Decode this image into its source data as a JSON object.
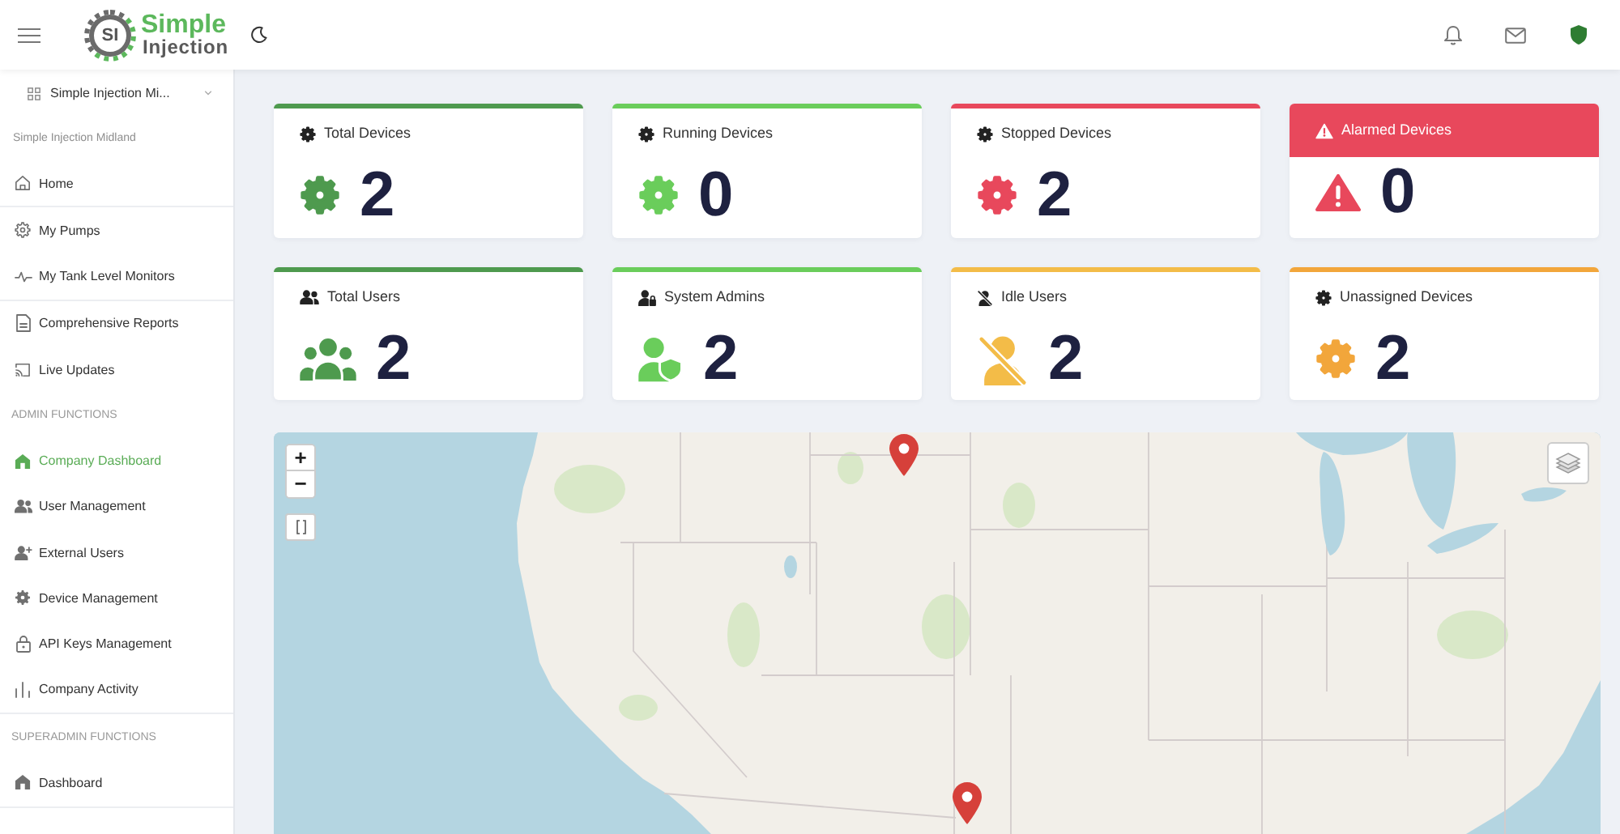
{
  "header": {
    "logo": {
      "badge": "SI",
      "name": "Simple",
      "tagline": "Injection"
    }
  },
  "sidebar": {
    "company_select": {
      "value": "Simple Injection Mi..."
    },
    "company_name": "Simple Injection Midland",
    "groups": [
      {
        "entries": [
          {
            "kind": "link",
            "label": "Home",
            "selected": false
          }
        ]
      },
      {
        "entries": [
          {
            "kind": "link",
            "label": "My Pumps",
            "selected": false
          },
          {
            "kind": "link",
            "label": "My Tank Level Monitors",
            "selected": false
          }
        ]
      },
      {
        "entries": [
          {
            "kind": "link",
            "label": "Comprehensive Reports",
            "selected": false
          },
          {
            "kind": "link",
            "label": "Live Updates",
            "selected": false
          },
          {
            "kind": "heading",
            "label": "ADMIN FUNCTIONS"
          },
          {
            "kind": "link",
            "label": "Company Dashboard",
            "selected": true
          },
          {
            "kind": "link",
            "label": "User Management",
            "selected": false
          },
          {
            "kind": "link",
            "label": "External Users",
            "selected": false
          },
          {
            "kind": "link",
            "label": "Device Management",
            "selected": false
          },
          {
            "kind": "link",
            "label": "API Keys Management",
            "selected": false
          },
          {
            "kind": "link",
            "label": "Company Activity",
            "selected": false
          }
        ]
      },
      {
        "entries": [
          {
            "kind": "heading",
            "label": "SUPERADMIN FUNCTIONS"
          },
          {
            "kind": "link",
            "label": "Dashboard",
            "selected": false
          }
        ]
      }
    ]
  },
  "stats": [
    {
      "kind": "stat",
      "title": "Total Devices",
      "value": "2",
      "color": "#4e9a4e"
    },
    {
      "kind": "stat",
      "title": "Running Devices",
      "value": "0",
      "color": "#6acd5b"
    },
    {
      "kind": "stat",
      "title": "Stopped Devices",
      "value": "2",
      "color": "#e8485c"
    },
    {
      "kind": "alert",
      "title": "Alarmed Devices",
      "value": "0",
      "color": "#e8485c"
    },
    {
      "kind": "stat",
      "title": "Total Users",
      "value": "2",
      "color": "#4e9a4e"
    },
    {
      "kind": "stat",
      "title": "System Admins",
      "value": "2",
      "color": "#6acd5b"
    },
    {
      "kind": "stat",
      "title": "Idle Users",
      "value": "2",
      "color": "#f3bc48"
    },
    {
      "kind": "stat",
      "title": "Unassigned Devices",
      "value": "2",
      "color": "#f2a63b"
    }
  ],
  "map": {
    "zoom_in": "+",
    "zoom_out": "−"
  }
}
